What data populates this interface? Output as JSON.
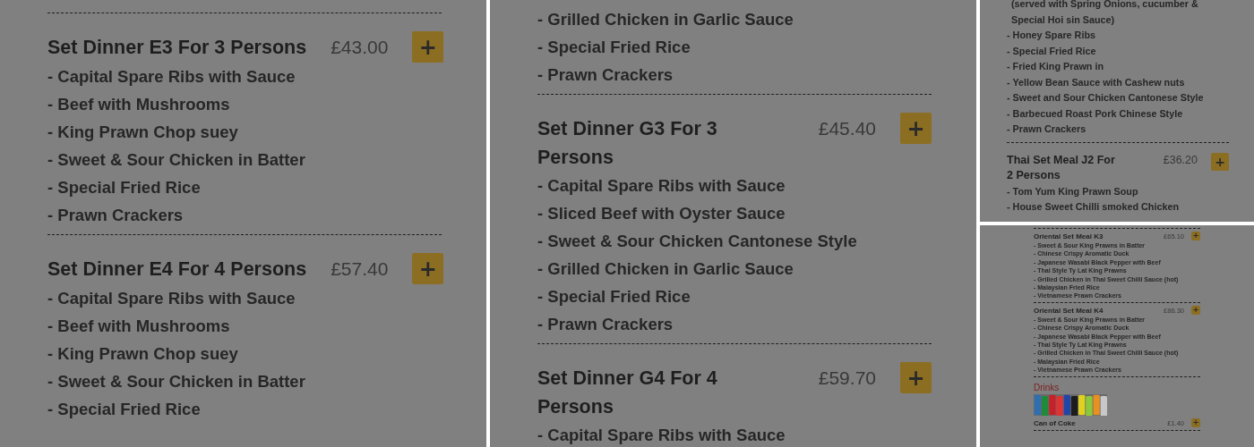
{
  "panels": [
    {
      "entries": [
        {
          "kind": "divider"
        },
        {
          "kind": "set",
          "title": "Set Dinner E3 For 3 Persons",
          "price": "£43.00",
          "button": "+",
          "dishes": [
            "- Capital Spare Ribs with Sauce",
            "- Beef with Mushrooms",
            "- King Prawn Chop suey",
            "- Sweet & Sour Chicken in Batter",
            "- Special Fried Rice",
            "- Prawn Crackers"
          ]
        },
        {
          "kind": "divider"
        },
        {
          "kind": "set",
          "title": "Set Dinner E4 For 4 Persons",
          "price": "£57.40",
          "button": "+",
          "dishes": [
            "- Capital Spare Ribs with Sauce",
            "- Beef with Mushrooms",
            "- King Prawn Chop suey",
            "- Sweet & Sour Chicken in Batter",
            "- Special Fried Rice"
          ]
        }
      ]
    },
    {
      "entries": [
        {
          "kind": "dish",
          "text": "- Grilled Chicken in Garlic Sauce"
        },
        {
          "kind": "dish",
          "text": "- Special Fried Rice"
        },
        {
          "kind": "dish",
          "text": "- Prawn Crackers"
        },
        {
          "kind": "divider"
        },
        {
          "kind": "set",
          "title": "Set Dinner G3 For 3 Persons",
          "price": "£45.40",
          "button": "+",
          "dishes": [
            "- Capital Spare Ribs with Sauce",
            "- Sliced Beef with Oyster Sauce",
            "- Sweet & Sour Chicken Cantonese Style",
            "- Grilled Chicken in Garlic Sauce",
            "- Special Fried Rice",
            "- Prawn Crackers"
          ]
        },
        {
          "kind": "divider"
        },
        {
          "kind": "set",
          "title": "Set Dinner G4 For 4 Persons",
          "price": "£59.70",
          "button": "+",
          "dishes": [
            "- Capital Spare Ribs with Sauce"
          ]
        }
      ]
    },
    {
      "entries": [
        {
          "kind": "note",
          "text": "(served with Spring Onions, cucumber & Special Hoi sin Sauce)"
        },
        {
          "kind": "dish",
          "text": "- Honey Spare Ribs"
        },
        {
          "kind": "dish",
          "text": "- Special Fried Rice"
        },
        {
          "kind": "dish",
          "text": "- Fried King Prawn in"
        },
        {
          "kind": "dish",
          "text": "- Yellow Bean Sauce with Cashew nuts"
        },
        {
          "kind": "dish",
          "text": "- Sweet and Sour Chicken Cantonese Style"
        },
        {
          "kind": "dish",
          "text": "- Barbecued Roast Pork Chinese Style"
        },
        {
          "kind": "dish",
          "text": "- Prawn Crackers"
        },
        {
          "kind": "divider"
        },
        {
          "kind": "set",
          "title": "Thai Set Meal J2 For 2 Persons",
          "price": "£36.20",
          "button": "+",
          "dishes": [
            "- Tom Yum King Prawn Soup",
            "- House Sweet Chilli smoked Chicken"
          ]
        }
      ]
    },
    {
      "entries": [
        {
          "kind": "divider"
        },
        {
          "kind": "set",
          "title": "Oriental Set Meal K3",
          "price": "£65.10",
          "button": "+",
          "dishes": [
            "- Sweet & Sour King Prawns in Batter",
            "- Chinese Crispy Aromatic Duck",
            "- Japanese Wasabi Black Pepper with Beef",
            "- Thai Style Ty Lat King Prawns",
            "- Grilled Chicken in Thai Sweet Chilli Sauce (hot)",
            "- Malaysian Fried Rice",
            "- Vietnamese Prawn Crackers"
          ]
        },
        {
          "kind": "divider"
        },
        {
          "kind": "set",
          "title": "Oriental Set Meal K4",
          "price": "£86.30",
          "button": "+",
          "dishes": [
            "- Sweet & Sour King Prawns in Batter",
            "- Chinese Crispy Aromatic Duck",
            "- Japanese Wasabi Black Pepper with Beef",
            "- Thai Style Ty Lat King Prawns",
            "- Grilled Chicken in Thai Sweet Chilli Sauce (hot)",
            "- Malaysian Fried Rice",
            "- Vietnamese Prawn Crackers"
          ]
        },
        {
          "kind": "divider"
        },
        {
          "kind": "section",
          "title": "Drinks"
        },
        {
          "kind": "picture"
        },
        {
          "kind": "set",
          "title": "Can of Coke",
          "price": "£1.40",
          "button": "+"
        },
        {
          "kind": "divider"
        }
      ]
    }
  ]
}
